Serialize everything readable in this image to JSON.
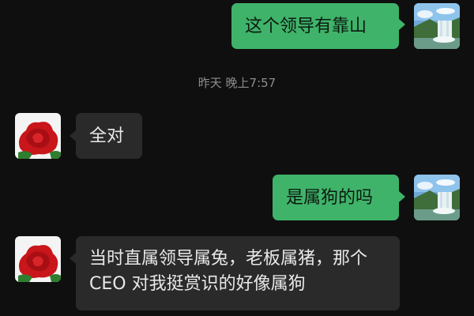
{
  "messages": [
    {
      "side": "out",
      "text": "这个领导有靠山",
      "avatar": "waterfall-avatar"
    },
    {
      "side": "in",
      "text": "全对",
      "avatar": "red-rose-avatar"
    },
    {
      "side": "out",
      "text": "是属狗的吗",
      "avatar": "waterfall-avatar"
    },
    {
      "side": "in",
      "text": "当时直属领导属兔，老板属猪，那个 CEO 对我挺赏识的好像属狗",
      "avatar": "red-rose-avatar"
    }
  ],
  "timestamp": "昨天 晚上7:57",
  "colors": {
    "background": "#0f0f0f",
    "outgoing_bubble": "#3fb36a",
    "incoming_bubble": "#2a2a2a",
    "timestamp_text": "#8d8d8d"
  }
}
